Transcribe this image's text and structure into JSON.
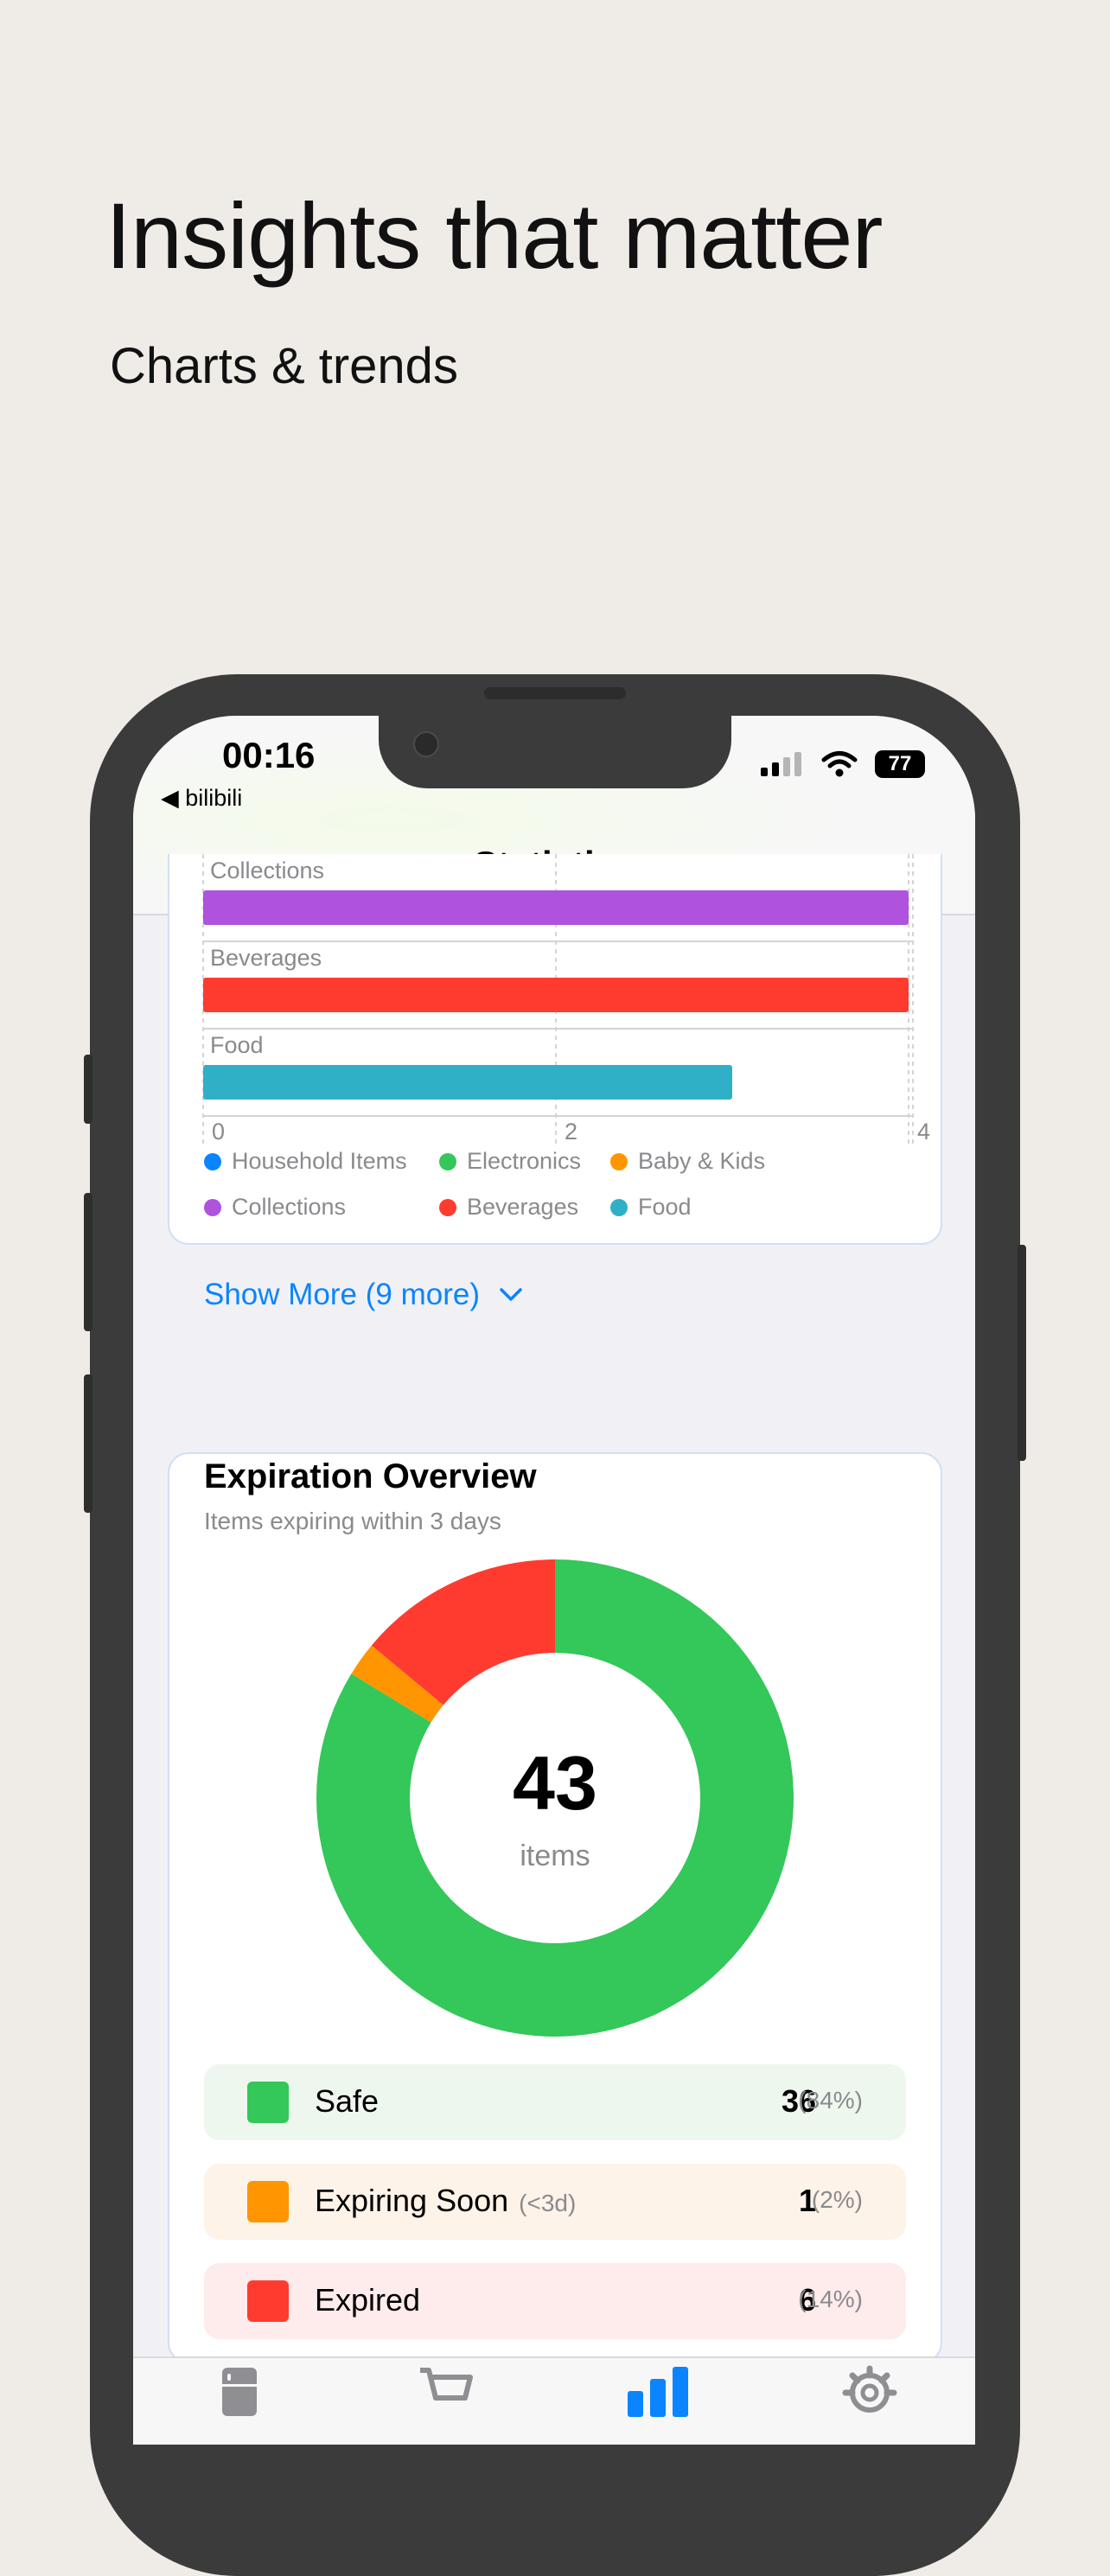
{
  "hero": {
    "title": "Insights that matter",
    "subtitle": "Charts & trends"
  },
  "status_bar": {
    "time": "00:16",
    "back_app": "◀ bilibili",
    "battery": "77"
  },
  "nav": {
    "title": "Statistics"
  },
  "category_chart": {
    "chart_data": {
      "type": "bar",
      "orientation": "horizontal",
      "categories": [
        "Collections",
        "Beverages",
        "Food"
      ],
      "values": [
        4,
        4,
        3
      ],
      "colors": [
        "#af52de",
        "#ff3b30",
        "#30b0c7"
      ],
      "xlim": [
        0,
        8
      ],
      "xticks": [
        "0",
        "2",
        "4",
        "6"
      ]
    },
    "legend": [
      {
        "label": "Household Items",
        "color": "#0a84ff"
      },
      {
        "label": "Electronics",
        "color": "#34c759"
      },
      {
        "label": "Baby & Kids",
        "color": "#ff9500"
      },
      {
        "label": "Collections",
        "color": "#af52de"
      },
      {
        "label": "Beverages",
        "color": "#ff3b30"
      },
      {
        "label": "Food",
        "color": "#30b0c7"
      }
    ],
    "show_more": "Show More (9 more)"
  },
  "expiration": {
    "title": "Expiration Overview",
    "subtitle": "Items expiring within 3 days",
    "total": "43",
    "total_label": "items",
    "chart_data": {
      "type": "pie",
      "donut": true,
      "categories": [
        "Safe",
        "Expiring Soon",
        "Expired"
      ],
      "values": [
        36,
        1,
        6
      ],
      "colors": [
        "#34c759",
        "#ff9500",
        "#ff3b30"
      ]
    },
    "rows": [
      {
        "label": "Safe",
        "note": "",
        "count": "36",
        "pct": "(84%)",
        "color": "#34c759",
        "bg": "#eef7ee"
      },
      {
        "label": "Expiring Soon",
        "note": "(<3d)",
        "count": "1",
        "pct": "(2%)",
        "color": "#ff9500",
        "bg": "#fdf3e8"
      },
      {
        "label": "Expired",
        "note": "",
        "count": "6",
        "pct": "(14%)",
        "color": "#ff3b30",
        "bg": "#fdeceb"
      }
    ]
  },
  "tabbar": {
    "icons": [
      "fridge-icon",
      "cart-icon",
      "chart-bar-icon",
      "gear-icon"
    ],
    "active_color": "#0a84ff"
  }
}
